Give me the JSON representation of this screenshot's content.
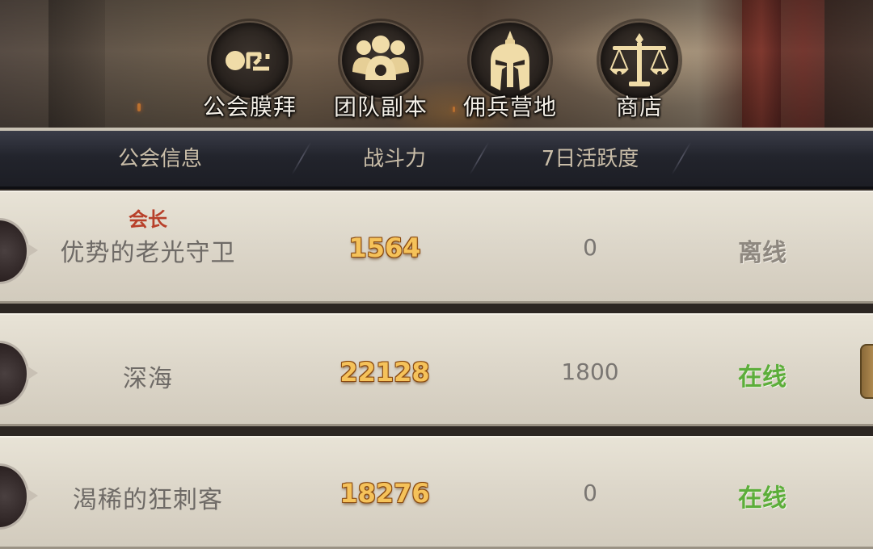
{
  "menu": [
    {
      "id": "guild-worship",
      "label": "公会膜拜",
      "icon": "orz-icon"
    },
    {
      "id": "team-dungeon",
      "label": "团队副本",
      "icon": "team-people-icon"
    },
    {
      "id": "mercenary-camp",
      "label": "佣兵营地",
      "icon": "spartan-helmet-icon"
    },
    {
      "id": "shop",
      "label": "商店",
      "icon": "balance-scale-icon"
    }
  ],
  "table": {
    "headers": {
      "guild_info": "公会信息",
      "power": "战斗力",
      "activity": "7日活跃度"
    },
    "rows": [
      {
        "rank": "会长",
        "name": "优势的老光守卫",
        "power": "1564",
        "activity": "0",
        "status": "离线",
        "online": false
      },
      {
        "rank": "",
        "name": "深海",
        "power": "22128",
        "activity": "1800",
        "status": "在线",
        "online": true
      },
      {
        "rank": "",
        "name": "渴稀的狂刺客",
        "power": "18276",
        "activity": "0",
        "status": "在线",
        "online": true
      }
    ]
  },
  "colors": {
    "online": "#5cae3a",
    "offline": "#8e8880",
    "power": "#f5c25a",
    "leader_rank": "#b8402a"
  }
}
